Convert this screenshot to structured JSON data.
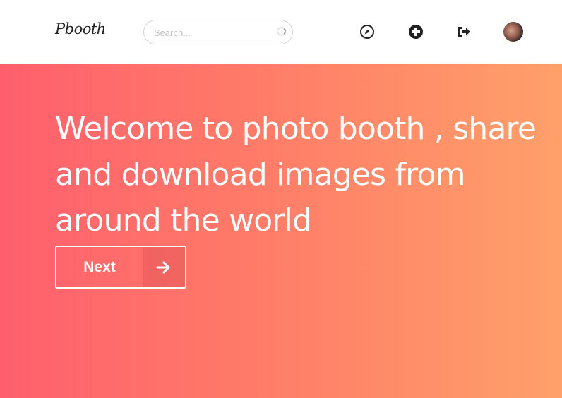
{
  "header": {
    "logo": "Pbooth",
    "search": {
      "placeholder": "Search...",
      "value": ""
    },
    "icons": [
      "compass-icon",
      "plus-circle-icon",
      "sign-out-icon",
      "user-avatar"
    ]
  },
  "hero": {
    "headline": "Welcome to photo booth , share and download images from around the world",
    "button_label": "Next",
    "button_icon": "arrow-right-icon"
  },
  "colors": {
    "gradient_start": "#ff5f6d",
    "gradient_end": "#ffa06a",
    "icon_color": "#222222"
  }
}
